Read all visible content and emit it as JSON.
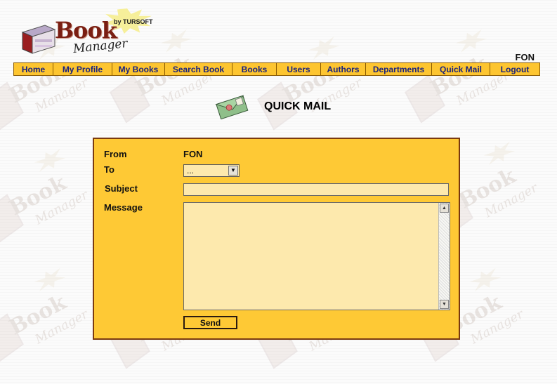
{
  "logo": {
    "word": "Book",
    "subword": "Manager",
    "by": "by TURSOFT"
  },
  "header": {
    "user_name": "FON"
  },
  "nav": {
    "items": [
      {
        "label": "Home"
      },
      {
        "label": "My Profile"
      },
      {
        "label": "My Books"
      },
      {
        "label": "Search Book"
      },
      {
        "label": "Books"
      },
      {
        "label": "Users"
      },
      {
        "label": "Authors"
      },
      {
        "label": "Departments"
      },
      {
        "label": "Quick Mail"
      },
      {
        "label": "Logout"
      }
    ]
  },
  "page": {
    "title": "QUICK MAIL",
    "title_icon": "envelope-icon"
  },
  "form": {
    "from_label": "From",
    "from_value": "FON",
    "to_label": "To",
    "to_selected": "...",
    "subject_label": "Subject",
    "subject_value": "",
    "message_label": "Message",
    "message_value": "",
    "send_label": "Send"
  },
  "colors": {
    "panel_bg": "#fec935",
    "panel_border": "#7a3a10",
    "nav_bg": "#fdc530",
    "nav_text": "#1a237e",
    "input_bg": "#fde9ad",
    "logo_brand": "#7a1e12"
  }
}
